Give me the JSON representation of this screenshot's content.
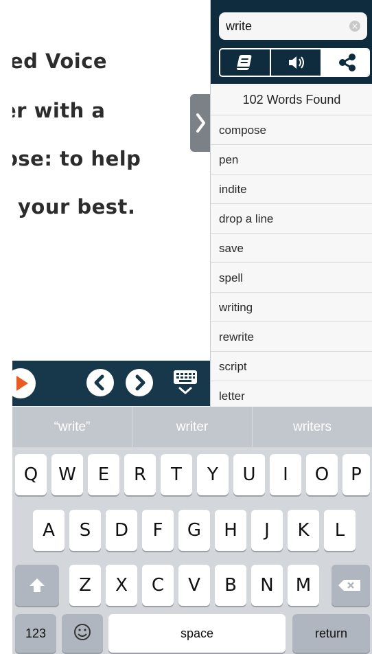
{
  "reader": {
    "lines": [
      "ed Voice",
      "er with a",
      "ose: to help",
      "your best."
    ]
  },
  "panel": {
    "search_value": "write",
    "found_text": "102 Words Found",
    "words": [
      "compose",
      "pen",
      "indite",
      "drop a line",
      "save",
      "spell",
      "writing",
      "rewrite",
      "script",
      "letter"
    ],
    "tabs": [
      "book-icon",
      "speaker-icon",
      "share-icon"
    ]
  },
  "keyboard": {
    "suggestions": [
      "“write”",
      "writer",
      "writers"
    ],
    "row1": [
      "Q",
      "W",
      "E",
      "R",
      "T",
      "Y",
      "U",
      "I",
      "O",
      "P"
    ],
    "row2": [
      "A",
      "S",
      "D",
      "F",
      "G",
      "H",
      "J",
      "K",
      "L"
    ],
    "row3": [
      "Z",
      "X",
      "C",
      "V",
      "B",
      "N",
      "M"
    ],
    "numbers_key": "123",
    "space_key": "space",
    "return_key": "return"
  },
  "colors": {
    "header": "#0f2c3e",
    "player_bar": "#16384a",
    "play_accent": "#ec5a24"
  }
}
